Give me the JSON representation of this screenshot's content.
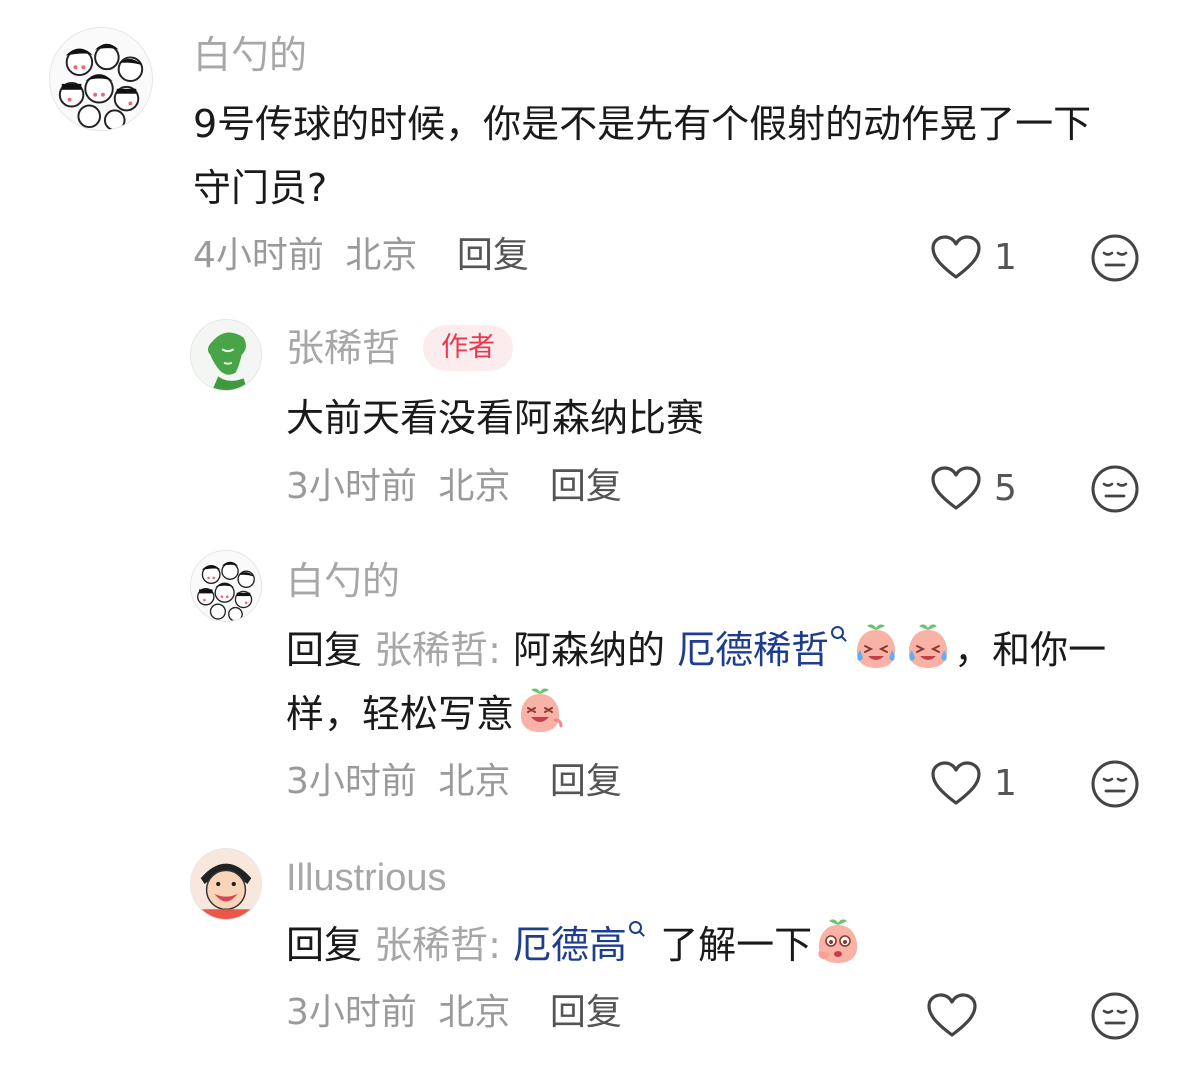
{
  "comments": [
    {
      "username": "白勺的",
      "text": "9号传球的时候，你是不是先有个假射的动作晃了一下守门员?",
      "time": "4小时前",
      "location": "北京",
      "reply_label": "回复",
      "likes": "1"
    },
    {
      "username": "张稀哲",
      "badge": "作者",
      "text": "大前天看没看阿森纳比赛",
      "time": "3小时前",
      "location": "北京",
      "reply_label": "回复",
      "likes": "5"
    },
    {
      "username": "白勺的",
      "reply_prefix": "回复",
      "reply_to": "张稀哲:",
      "text_before": "阿森纳的",
      "link_text": "厄德稀哲",
      "text_after_1": "，和你一样，轻松写意",
      "time": "3小时前",
      "location": "北京",
      "reply_label": "回复",
      "likes": "1"
    },
    {
      "username": "Illustrious",
      "reply_prefix": "回复",
      "reply_to": "张稀哲:",
      "link_text": "厄德高",
      "text_after": "了解一下",
      "time": "3小时前",
      "location": "北京",
      "reply_label": "回复",
      "likes": ""
    }
  ],
  "icons": {
    "like": "heart-outline-icon",
    "dislike": "meh-face-icon",
    "search_link": "search-icon",
    "emoji_crying": "crying-laughing-peach-emoji",
    "emoji_laughing": "laughing-peach-emoji",
    "emoji_ogling": "ogling-peach-emoji"
  },
  "colors": {
    "username": "#a7a7a7",
    "link": "#1e3d8f",
    "author_badge_text": "#e8394f",
    "author_badge_bg": "#fdecee"
  }
}
